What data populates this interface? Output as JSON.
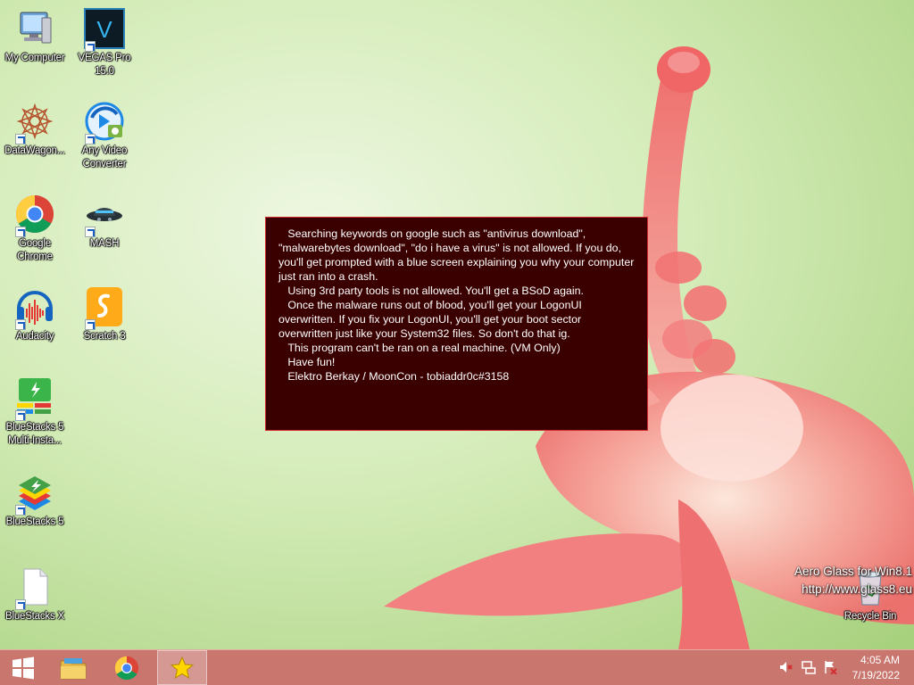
{
  "desktop_icons": [
    {
      "label": "My Computer",
      "icon": "computer-icon"
    },
    {
      "label": "VEGAS Pro 15.0",
      "icon": "vegas-pro-icon"
    },
    {
      "label": "DataWagon...",
      "icon": "datawagon-icon"
    },
    {
      "label": "Any Video Converter",
      "icon": "any-video-converter-icon"
    },
    {
      "label": "Google Chrome",
      "icon": "chrome-icon"
    },
    {
      "label": "MASH",
      "icon": "mash-icon"
    },
    {
      "label": "Audacity",
      "icon": "audacity-icon"
    },
    {
      "label": "Scratch 3",
      "icon": "scratch-icon"
    },
    {
      "label": "BlueStacks 5 Multi-Insta...",
      "icon": "bluestacks-multi-icon"
    },
    {
      "label": "BlueStacks 5",
      "icon": "bluestacks-icon"
    },
    {
      "label": "BlueStacks X",
      "icon": "file-icon"
    },
    {
      "label": "Recycle Bin",
      "icon": "recycle-bin-icon"
    }
  ],
  "message": {
    "lines": [
      "   Searching keywords on google such as \"antivirus download\", \"malwarebytes download\", \"do i have a virus\" is not allowed. If you do, you'll get prompted with a blue screen explaining you why your computer just ran into a crash.",
      "   Using 3rd party tools is not allowed. You'll get a BSoD again.",
      "   Once the malware runs out of blood, you'll get your LogonUI overwritten. If you fix your LogonUI, you'll get your boot sector overwritten just like your System32 files. So don't do that ig.",
      "   This program can't be ran on a real machine. (VM Only)",
      "",
      "   Have fun!",
      "   Elektro Berkay / MoonCon - tobiaddr0c#3158"
    ]
  },
  "watermark": {
    "line1": "Aero Glass for Win8.1",
    "line2": "http://www.glass8.eu"
  },
  "taskbar": {
    "buttons": [
      {
        "icon": "start-windows-icon"
      },
      {
        "icon": "file-explorer-icon"
      },
      {
        "icon": "chrome-icon"
      },
      {
        "icon": "star-app-icon"
      }
    ],
    "tray": [
      {
        "icon": "volume-muted-icon"
      },
      {
        "icon": "network-icon"
      },
      {
        "icon": "action-center-flag-icon"
      }
    ],
    "clock": {
      "time": "4:05 AM",
      "date": "7/19/2022"
    }
  },
  "colors": {
    "message_bg": "#3a0000",
    "message_border": "#d12a2a",
    "taskbar": "#c8766e",
    "wallpaper_green": "#cfe8b4",
    "flower_pink": "#f07a7a"
  }
}
